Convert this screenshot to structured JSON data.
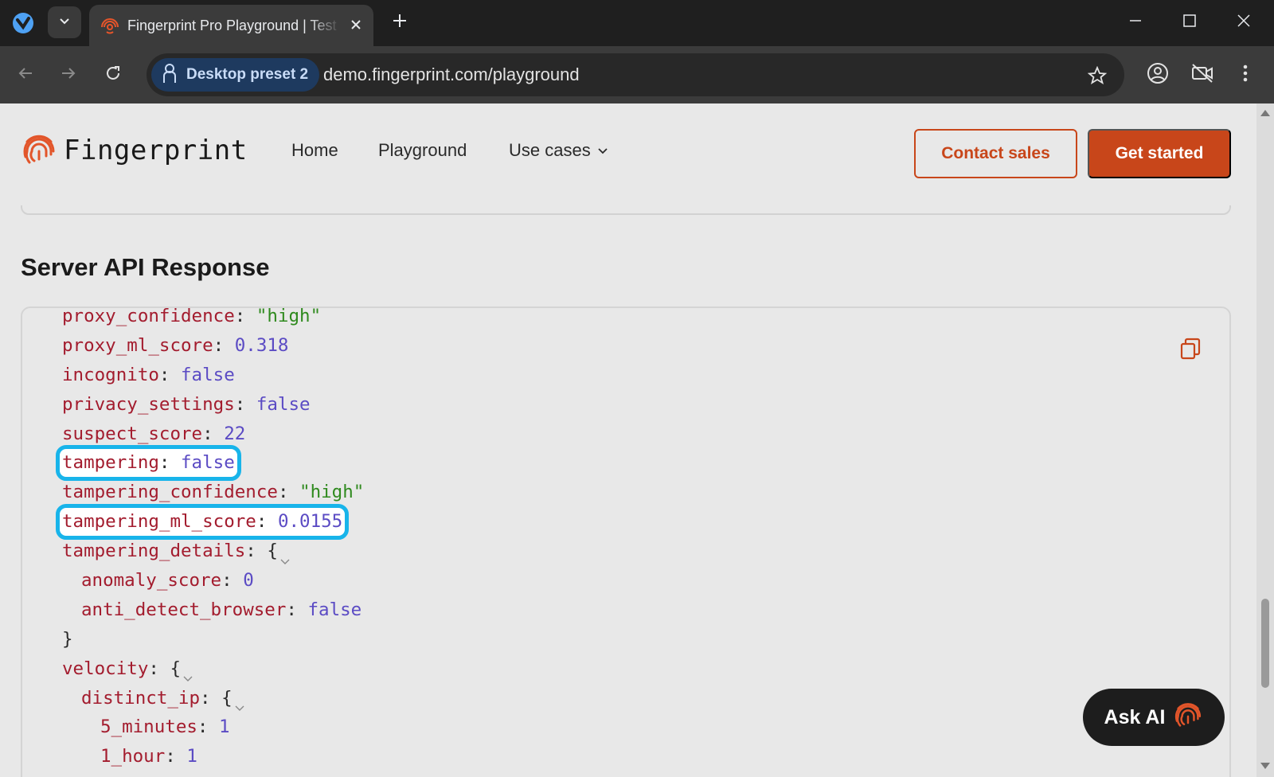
{
  "browser": {
    "tab_title": "Fingerprint Pro Playground | Test",
    "profile_label": "Desktop preset 2",
    "url": "demo.fingerprint.com/playground"
  },
  "site": {
    "brand": "Fingerprint",
    "nav": {
      "home": "Home",
      "playground": "Playground",
      "use_cases": "Use cases"
    },
    "contact_sales": "Contact sales",
    "get_started": "Get started"
  },
  "section_title": "Server API Response",
  "code": {
    "l1": {
      "key": "proxy_confidence",
      "value": "\"high\""
    },
    "l2": {
      "key": "proxy_ml_score",
      "value": "0.318"
    },
    "l3": {
      "key": "incognito",
      "value": "false"
    },
    "l4": {
      "key": "privacy_settings",
      "value": "false"
    },
    "l5": {
      "key": "suspect_score",
      "value": "22"
    },
    "l6": {
      "key": "tampering",
      "value": "false"
    },
    "l7": {
      "key": "tampering_confidence",
      "value": "\"high\""
    },
    "l8": {
      "key": "tampering_ml_score",
      "value": "0.0155"
    },
    "l9": {
      "key": "tampering_details"
    },
    "l10": {
      "key": "anomaly_score",
      "value": "0"
    },
    "l11": {
      "key": "anti_detect_browser",
      "value": "false"
    },
    "l13": {
      "key": "velocity"
    },
    "l14": {
      "key": "distinct_ip"
    },
    "l15": {
      "key": "5_minutes",
      "value": "1"
    },
    "l16": {
      "key": "1_hour",
      "value": "1"
    }
  },
  "ask_ai": "Ask AI",
  "colors": {
    "brand_orange": "#c8461a",
    "json_key": "#a31c2e",
    "json_string": "#2f8a1e",
    "json_literal": "#5b4bc4",
    "highlight_outline": "#18b4ea"
  }
}
